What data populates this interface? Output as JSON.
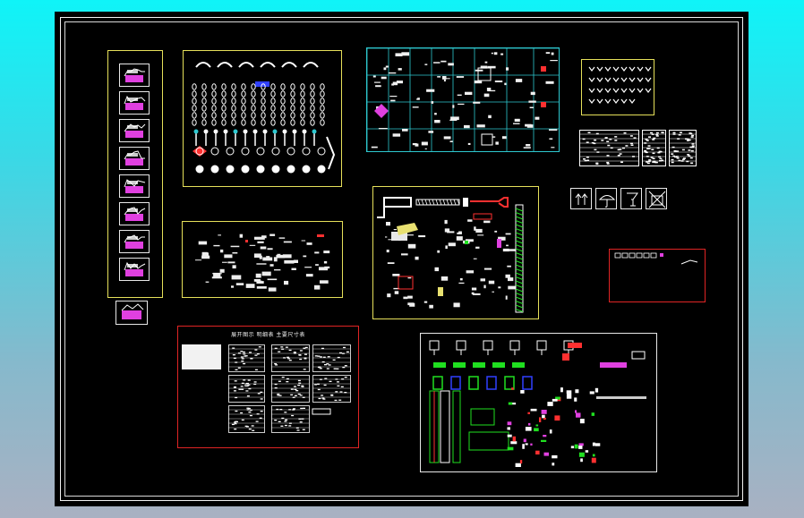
{
  "drawing": {
    "background_color": "#000000",
    "frame_color": "#f2f2f2",
    "colors": {
      "yellow_frame": "#e6e05a",
      "cyan_frame": "#2ec8d0",
      "red_frame": "#e02424",
      "magenta": "#e040e0",
      "blue": "#3040ff",
      "green": "#20e020",
      "red": "#ff3030"
    }
  },
  "blocks": {
    "column_thumbnails": {
      "count": 9
    },
    "ornaments": {
      "description_icon": "ornament-grid-icon"
    },
    "table_sheet": {
      "title": "展开图示 明细表 主要尺寸表"
    },
    "packaging_symbols": {
      "icons": [
        "this-way-up-icon",
        "keep-dry-icon",
        "fragile-icon",
        "do-not-stack-icon"
      ]
    }
  }
}
